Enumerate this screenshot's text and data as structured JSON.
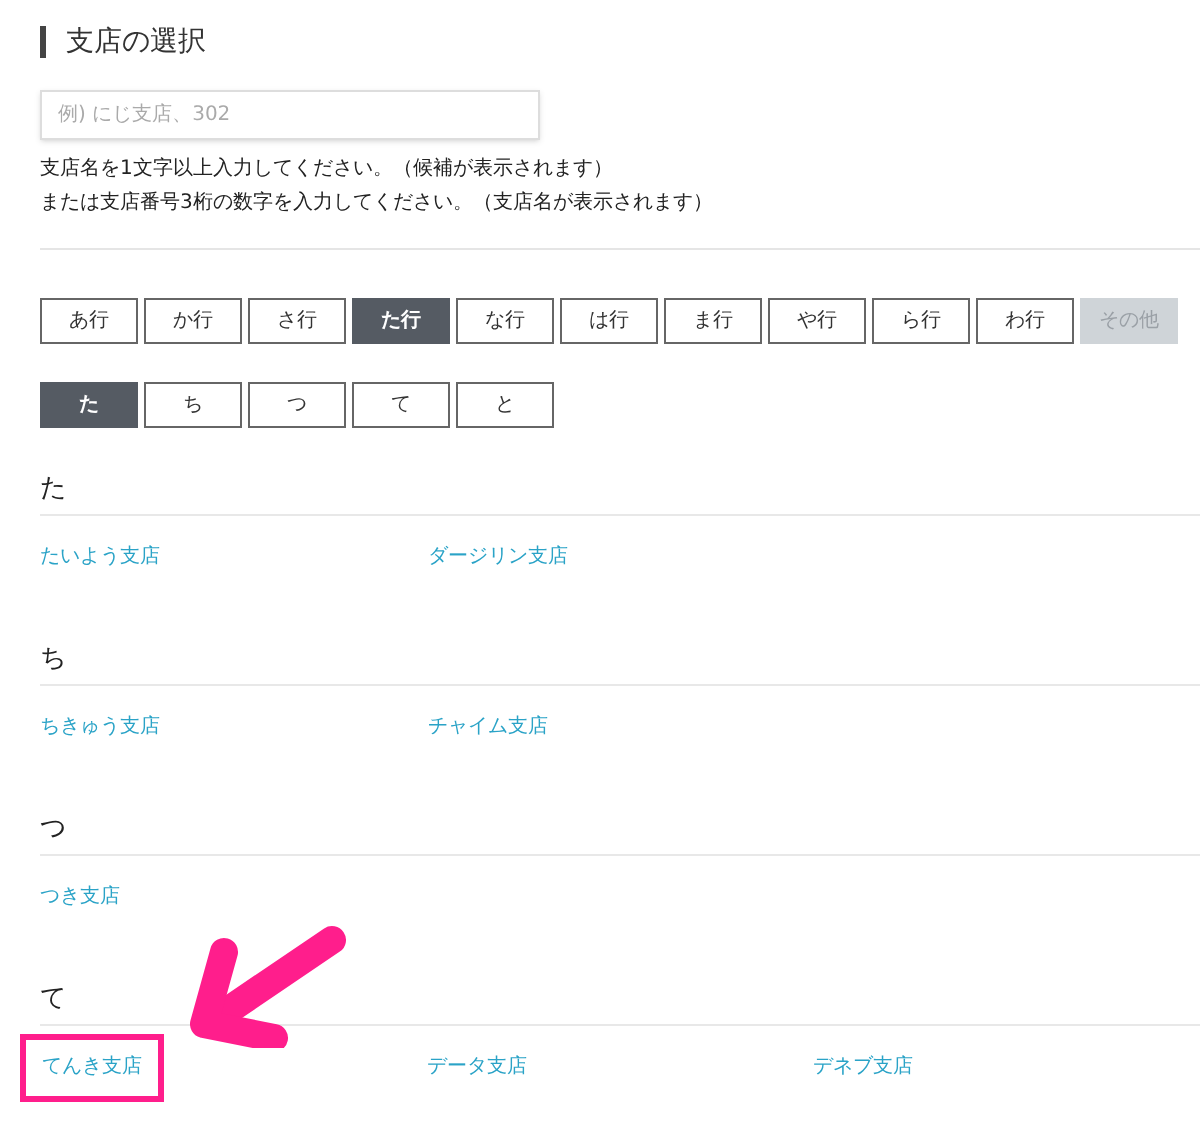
{
  "title": "支店の選択",
  "search": {
    "placeholder": "例) にじ支店、302"
  },
  "hints": [
    "支店名を1文字以上入力してください。（候補が表示されます）",
    "または支店番号3桁の数字を入力してください。（支店名が表示されます）"
  ],
  "row_tabs": [
    {
      "label": "あ行",
      "selected": false,
      "disabled": false
    },
    {
      "label": "か行",
      "selected": false,
      "disabled": false
    },
    {
      "label": "さ行",
      "selected": false,
      "disabled": false
    },
    {
      "label": "た行",
      "selected": true,
      "disabled": false
    },
    {
      "label": "な行",
      "selected": false,
      "disabled": false
    },
    {
      "label": "は行",
      "selected": false,
      "disabled": false
    },
    {
      "label": "ま行",
      "selected": false,
      "disabled": false
    },
    {
      "label": "や行",
      "selected": false,
      "disabled": false
    },
    {
      "label": "ら行",
      "selected": false,
      "disabled": false
    },
    {
      "label": "わ行",
      "selected": false,
      "disabled": false
    },
    {
      "label": "その他",
      "selected": false,
      "disabled": true
    }
  ],
  "kana_tabs": [
    {
      "label": "た",
      "selected": true
    },
    {
      "label": "ち",
      "selected": false
    },
    {
      "label": "つ",
      "selected": false
    },
    {
      "label": "て",
      "selected": false
    },
    {
      "label": "と",
      "selected": false
    }
  ],
  "sections": [
    {
      "heading": "た",
      "branches": [
        {
          "name": "たいよう支店",
          "highlighted": false
        },
        {
          "name": "ダージリン支店",
          "highlighted": false
        }
      ]
    },
    {
      "heading": "ち",
      "branches": [
        {
          "name": "ちきゅう支店",
          "highlighted": false
        },
        {
          "name": "チャイム支店",
          "highlighted": false
        }
      ]
    },
    {
      "heading": "つ",
      "branches": [
        {
          "name": "つき支店",
          "highlighted": false
        }
      ]
    },
    {
      "heading": "て",
      "branches": [
        {
          "name": "てんき支店",
          "highlighted": true
        },
        {
          "name": "データ支店",
          "highlighted": false
        },
        {
          "name": "デネブ支店",
          "highlighted": false
        }
      ]
    }
  ]
}
